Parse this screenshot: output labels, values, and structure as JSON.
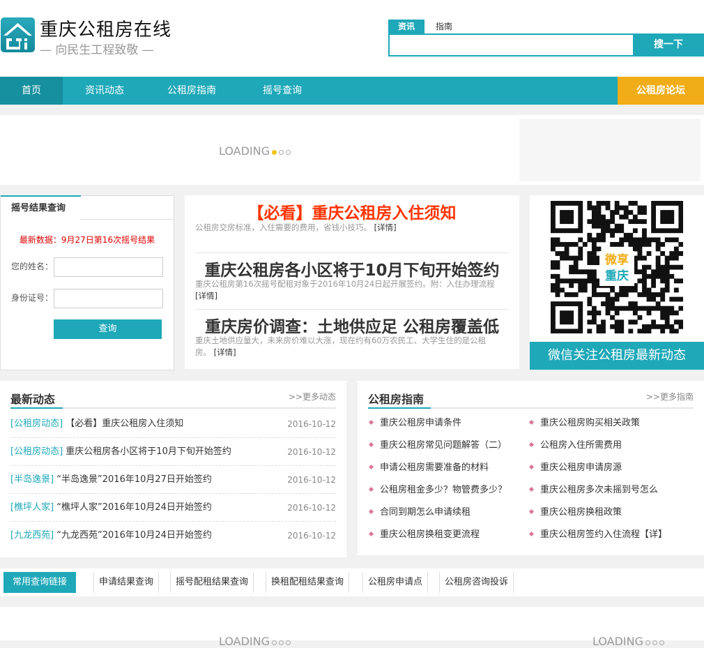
{
  "header": {
    "title": "重庆公租房在线",
    "slogan": "— 向民生工程致敬 —"
  },
  "search": {
    "tabs": [
      "资讯",
      "指南"
    ],
    "placeholder": "",
    "button": "搜一下"
  },
  "nav": {
    "items": [
      "首页",
      "资讯动态",
      "公租房指南",
      "摇号查询"
    ],
    "forum": "公租房论坛"
  },
  "banner": {
    "loading": "LOADING"
  },
  "query": {
    "tab": "摇号结果查询",
    "notice": "最新数据：9月27日第16次摇号结果",
    "name_label": "您的姓名：",
    "id_label": "身份证号：",
    "button": "查询"
  },
  "news": [
    {
      "title": "【必看】重庆公租房入住须知",
      "desc": "公租房交房标准，入住需要的费用，省钱小技巧。",
      "more": "[详情]"
    },
    {
      "title": "重庆公租房各小区将于10月下旬开始签约",
      "desc": "重庆公租房第16次摇号配租对象于2016年10月24日起开展签约。附：入住办理流程",
      "more": "[详情]"
    },
    {
      "title": "重庆房价调查：土地供应足 公租房覆盖低",
      "desc": "重庆土地供应量大，未来房价难以大涨，现在约有60万农民工、大学生住的是公租房。",
      "more": "[详情]"
    }
  ],
  "qr": {
    "logo_top": "微享",
    "logo_bottom": "重庆",
    "caption": "微信关注公租房最新动态"
  },
  "latest": {
    "title": "最新动态",
    "more": ">>更多动态",
    "items": [
      {
        "cat": "[公租房动态]",
        "title": "【必看】重庆公租房入住须知",
        "date": "2016-10-12"
      },
      {
        "cat": "[公租房动态]",
        "title": "重庆公租房各小区将于10月下旬开始签约",
        "date": "2016-10-12"
      },
      {
        "cat": "[半岛逸景]",
        "title": "“半岛逸景”2016年10月27日开始签约",
        "date": "2016-10-12"
      },
      {
        "cat": "[樵坪人家]",
        "title": "“樵坪人家”2016年10月24日开始签约",
        "date": "2016-10-12"
      },
      {
        "cat": "[九龙西苑]",
        "title": "“九龙西苑”2016年10月24日开始签约",
        "date": "2016-10-12"
      }
    ]
  },
  "guide": {
    "title": "公租房指南",
    "more": ">>更多指南",
    "items": [
      "重庆公租房申请条件",
      "重庆公租房购买相关政策",
      "重庆公租房常见问题解答（二）",
      "公租房入住所需费用",
      "申请公租房需要准备的材料",
      "重庆公租房申请房源",
      "公租房租金多少？物管费多少？",
      "重庆公租房多次未摇到号怎么",
      "合同到期怎么申请续租",
      "重庆公租房换租政策",
      "重庆公租房换租变更流程",
      "重庆公租房签约入住流程【详】"
    ]
  },
  "links": {
    "label": "常用查询链接",
    "items": [
      "申请结果查询",
      "摇号配租结果查询",
      "换租配租结果查询",
      "公租房申请点",
      "公租房咨询投诉"
    ]
  },
  "colors": {
    "teal": "#1ea8b8",
    "orange": "#f0ad17",
    "red": "#ff3300"
  }
}
